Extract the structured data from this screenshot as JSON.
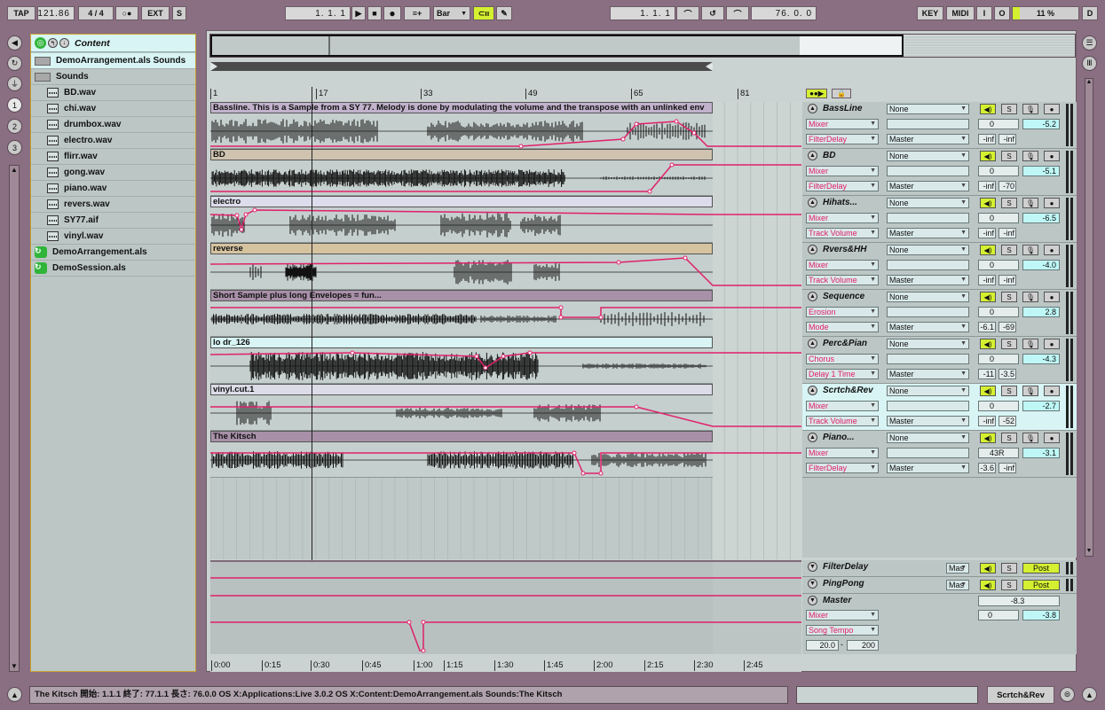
{
  "transport": {
    "tap": "TAP",
    "tempo": "121.86",
    "signature": "4 / 4",
    "metro": "○●",
    "ext": "EXT",
    "s": "S",
    "position": "1.   1.   1",
    "quantize": "Bar",
    "follow": "⊂ıı",
    "loop_start": "1.   1.   1",
    "loop_length": "76.   0.   0",
    "key": "KEY",
    "midi": "MIDI",
    "in": "I",
    "out": "O",
    "cpu": "11 %",
    "d": "D"
  },
  "browser": {
    "title": "Content",
    "items": [
      {
        "label": "DemoArrangement.als Sounds",
        "kind": "folder"
      },
      {
        "label": "Sounds",
        "kind": "folder"
      },
      {
        "label": "BD.wav",
        "kind": "wav"
      },
      {
        "label": "chi.wav",
        "kind": "wav"
      },
      {
        "label": "drumbox.wav",
        "kind": "wav"
      },
      {
        "label": "electro.wav",
        "kind": "wav"
      },
      {
        "label": "flirr.wav",
        "kind": "wav"
      },
      {
        "label": "gong.wav",
        "kind": "wav"
      },
      {
        "label": "piano.wav",
        "kind": "wav"
      },
      {
        "label": "revers.wav",
        "kind": "wav"
      },
      {
        "label": "SY77.aif",
        "kind": "wav"
      },
      {
        "label": "vinyl.wav",
        "kind": "wav"
      },
      {
        "label": "DemoArrangement.als",
        "kind": "als"
      },
      {
        "label": "DemoSession.als",
        "kind": "als"
      }
    ]
  },
  "ruler": {
    "bars": [
      "1",
      "17",
      "33",
      "49",
      "65",
      "81"
    ],
    "times": [
      "0:00",
      "0:15",
      "0:30",
      "0:45",
      "1:00",
      "1:15",
      "1:30",
      "1:45",
      "2:00",
      "2:15",
      "2:30",
      "2:45"
    ]
  },
  "tracks": [
    {
      "clip": "Bassline. This is a Sample from a SY 77. Melody is done by modulating the volume and the transpose with an unlinked env",
      "clip_color": "#c2b2cc",
      "name": "BassLine",
      "dev1": "Mixer",
      "dev2": "FilterDelay",
      "input": "None",
      "output": "Master",
      "vol": "0",
      "pan": "-5.2",
      "m1": "-inf",
      "m2": "-inf"
    },
    {
      "clip": "BD",
      "clip_color": "#cfc3b0",
      "name": "BD",
      "dev1": "Mixer",
      "dev2": "FilterDelay",
      "input": "None",
      "output": "Master",
      "vol": "0",
      "pan": "-5.1",
      "m1": "-inf",
      "m2": "-70"
    },
    {
      "clip": "electro",
      "clip_color": "#dcdcec",
      "name": "Hihats...",
      "dev1": "Mixer",
      "dev2": "Track Volume",
      "input": "None",
      "output": "Master",
      "vol": "0",
      "pan": "-6.5",
      "m1": "-inf",
      "m2": "-inf"
    },
    {
      "clip": "reverse",
      "clip_color": "#d5c3a0",
      "name": "Rvers&HH",
      "dev1": "Mixer",
      "dev2": "Track Volume",
      "input": "None",
      "output": "Master",
      "vol": "0",
      "pan": "-4.0",
      "m1": "-inf",
      "m2": "-inf"
    },
    {
      "clip": "Short Sample plus long Envelopes = fun...",
      "clip_color": "#a890a8",
      "name": "Sequence",
      "dev1": "Erosion",
      "dev2": "Mode",
      "input": "None",
      "output": "Master",
      "vol": "0",
      "pan": "2.8",
      "m1": "-6.1",
      "m2": "-69"
    },
    {
      "clip": "lo dr_126",
      "clip_color": "#d8f4f4",
      "name": "Perc&Pian",
      "dev1": "Chorus",
      "dev2": "Delay 1 Time",
      "input": "None",
      "output": "Master",
      "vol": "0",
      "pan": "-4.3",
      "m1": "-11",
      "m2": "-3.5"
    },
    {
      "clip": "vinyl.cut.1",
      "clip_color": "#dcdce8",
      "name": "Scrtch&Rev",
      "dev1": "Mixer",
      "dev2": "Track Volume",
      "input": "None",
      "output": "Master",
      "vol": "0",
      "pan": "-2.7",
      "m1": "-inf",
      "m2": "-52"
    },
    {
      "clip": "The Kitsch",
      "clip_color": "#a890a8",
      "name": "Piano...",
      "dev1": "Mixer",
      "dev2": "FilterDelay",
      "input": "None",
      "output": "Master",
      "vol": "43R",
      "pan": "-3.1",
      "m1": "-3.6",
      "m2": "-inf"
    }
  ],
  "returns": [
    {
      "name": "FilterDelay",
      "out": "Mas",
      "post": "Post"
    },
    {
      "name": "PingPong",
      "out": "Mas",
      "post": "Post"
    }
  ],
  "master": {
    "name": "Master",
    "dev1": "Mixer",
    "dev2": "Song Tempo",
    "t1": "20.0",
    "t2": "200",
    "vol": "-8.3",
    "pan_l": "0",
    "pan": "-3.8",
    "dash": "-"
  },
  "status": {
    "text": "The Kitsch  開始: 1.1.1  終了: 77.1.1  長さ: 76.0.0  OS X:Applications:Live 3.0.2 OS X:Content:DemoArrangement.als Sounds:The Kitsch",
    "selected_track": "Scrtch&Rev"
  },
  "colors": {
    "accent": "#e0206a",
    "cyan": "#bff7f7",
    "yellow_green": "#d4f030"
  }
}
